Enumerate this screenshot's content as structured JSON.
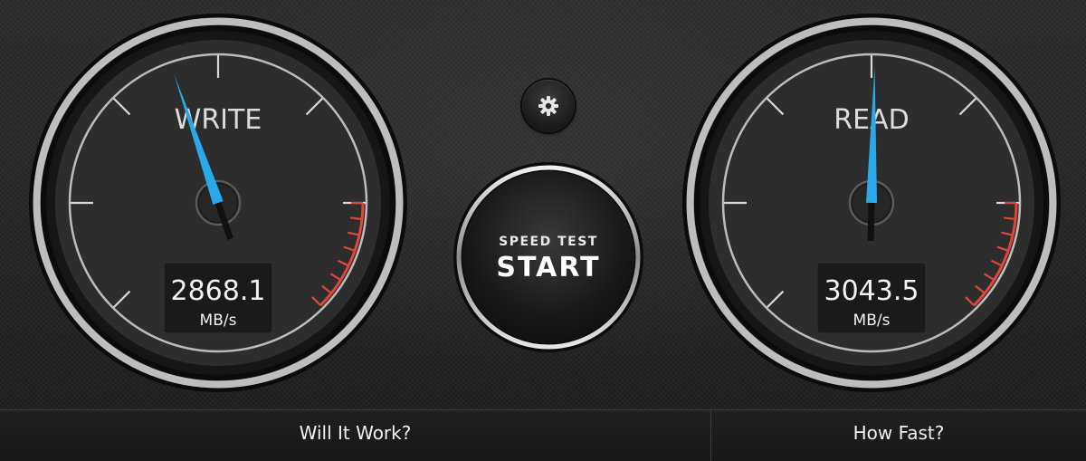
{
  "gauges": {
    "write": {
      "label": "WRITE",
      "value": "2868.1",
      "unit": "MB/s",
      "needle_fraction": 0.43
    },
    "read": {
      "label": "READ",
      "value": "3043.5",
      "unit": "MB/s",
      "needle_fraction": 0.505
    }
  },
  "start_button": {
    "subtitle": "SPEED TEST",
    "label": "START"
  },
  "settings": {
    "icon": "gear-icon"
  },
  "bottom_bar": {
    "left_label": "Will It Work?",
    "right_label": "How Fast?"
  },
  "colors": {
    "needle": "#2aa8e8",
    "redline": "#e2453a",
    "gauge_ring": "#c9c9c9",
    "ticks": "#d8d8d8"
  }
}
